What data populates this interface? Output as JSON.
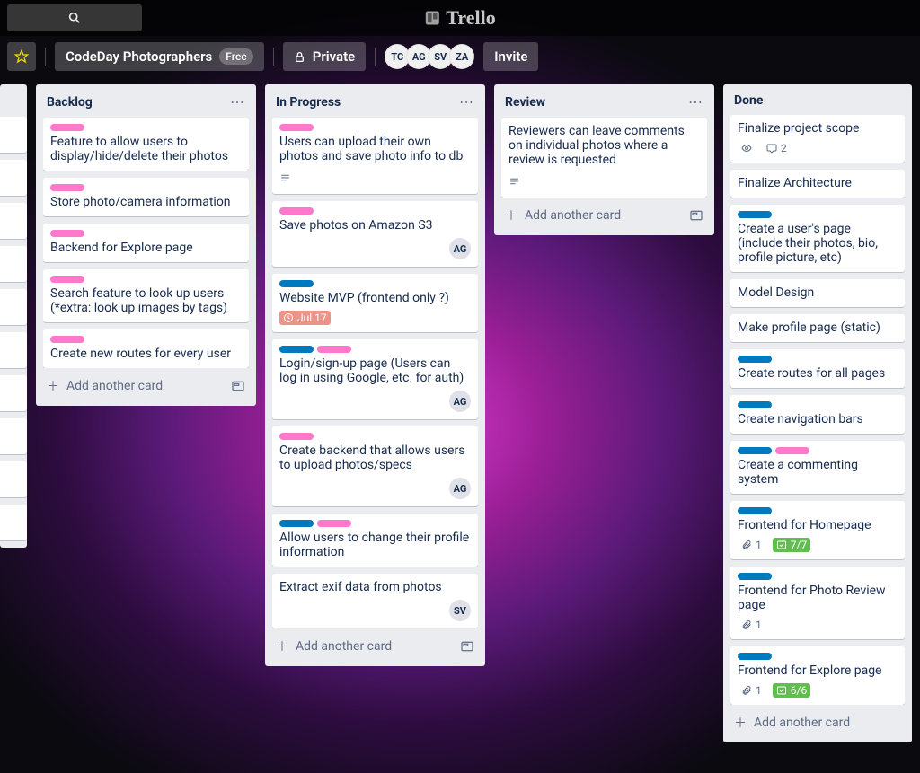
{
  "brand": "Trello",
  "board": {
    "name": "CodeDay Photographers",
    "plan": "Free",
    "visibility": "Private",
    "invite": "Invite",
    "members": [
      "TC",
      "AG",
      "SV",
      "ZA"
    ]
  },
  "add_card_label": "Add another card",
  "lists": {
    "backlog": {
      "title": "Backlog",
      "cards": [
        {
          "labels": [
            "pink"
          ],
          "text": "Feature to allow users to display/hide/delete their photos"
        },
        {
          "labels": [
            "pink"
          ],
          "text": "Store photo/camera information"
        },
        {
          "labels": [
            "pink"
          ],
          "text": "Backend for Explore page"
        },
        {
          "labels": [
            "pink"
          ],
          "text": "Search feature to look up users (*extra: look up images by tags)"
        },
        {
          "labels": [
            "pink"
          ],
          "text": "Create new routes for every user"
        }
      ]
    },
    "inprogress": {
      "title": "In Progress",
      "cards": [
        {
          "labels": [
            "pink"
          ],
          "text": "Users can upload their own photos and save photo info to db",
          "desc": true
        },
        {
          "labels": [
            "pink"
          ],
          "text": "Save photos on Amazon S3",
          "member": "AG"
        },
        {
          "labels": [
            "blue"
          ],
          "text": "Website MVP (frontend only ?)",
          "due": "Jul 17"
        },
        {
          "labels": [
            "blue",
            "pink"
          ],
          "text": "Login/sign-up page (Users can log in using Google, etc. for auth)",
          "member": "AG"
        },
        {
          "labels": [
            "pink"
          ],
          "text": "Create backend that allows users to upload photos/specs",
          "member": "AG"
        },
        {
          "labels": [
            "blue",
            "pink"
          ],
          "text": "Allow users to change their profile information"
        },
        {
          "labels": [],
          "text": "Extract exif data from photos",
          "member": "SV"
        }
      ]
    },
    "review": {
      "title": "Review",
      "cards": [
        {
          "labels": [],
          "text": "Reviewers can leave comments on individual photos where a review is requested",
          "desc": true
        }
      ]
    },
    "done": {
      "title": "Done",
      "cards": [
        {
          "labels": [],
          "text": "Finalize project scope",
          "watch": true,
          "comments": "2"
        },
        {
          "labels": [],
          "text": "Finalize Architecture"
        },
        {
          "labels": [
            "blue"
          ],
          "text": "Create a user's page (include their photos, bio, profile picture, etc)"
        },
        {
          "labels": [],
          "text": "Model Design"
        },
        {
          "labels": [],
          "text": "Make profile page (static)"
        },
        {
          "labels": [
            "blue"
          ],
          "text": "Create routes for all pages"
        },
        {
          "labels": [
            "blue"
          ],
          "text": "Create navigation bars"
        },
        {
          "labels": [
            "blue",
            "pink"
          ],
          "text": "Create a commenting system"
        },
        {
          "labels": [
            "blue"
          ],
          "text": "Frontend for Homepage",
          "attach": "1",
          "check": "7/7",
          "check_done": true
        },
        {
          "labels": [
            "blue"
          ],
          "text": "Frontend for Photo Review page",
          "attach": "1"
        },
        {
          "labels": [
            "blue"
          ],
          "text": "Frontend for Explore page",
          "attach": "1",
          "check": "6/6",
          "check_done": true
        }
      ]
    }
  }
}
